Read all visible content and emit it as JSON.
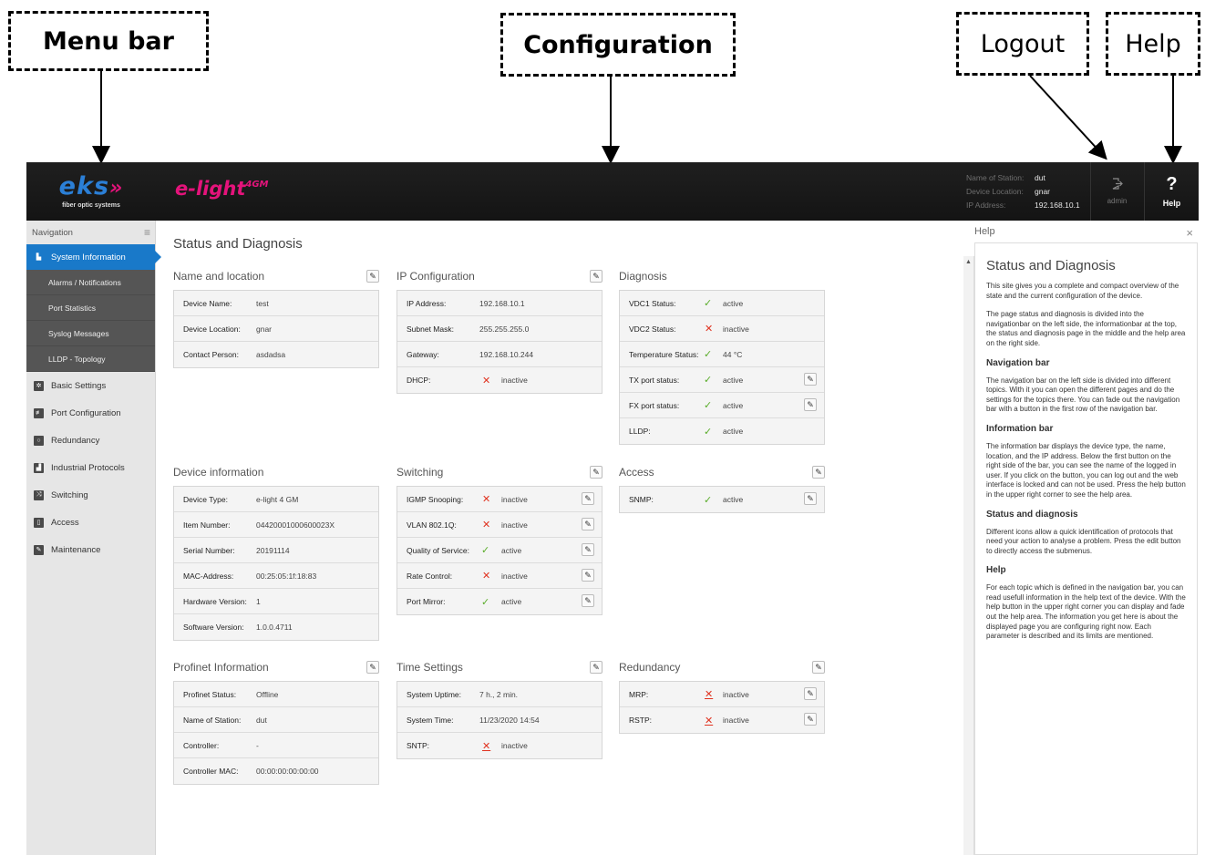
{
  "annotations": {
    "menu_bar": "Menu bar",
    "configuration": "Configuration",
    "logout": "Logout",
    "help": "Help"
  },
  "topbar": {
    "brand": "eks",
    "brand_chevron": "»",
    "brand_tagline": "fiber optic systems",
    "product": "e-light",
    "product_sup": "4GM",
    "station_name_label": "Name of Station:",
    "station_name": "dut",
    "location_label": "Device Location:",
    "location": "gnar",
    "ip_label": "IP Address:",
    "ip": "192.168.10.1",
    "admin_label": "admin",
    "help_symbol": "?",
    "help_label": "Help"
  },
  "sidebar": {
    "header": "Navigation",
    "menu_icon": "≡",
    "items": [
      {
        "label": "System Information",
        "icon": "chart-icon"
      },
      {
        "label": "Basic Settings",
        "icon": "gear-icon"
      },
      {
        "label": "Port Configuration",
        "icon": "port-icon"
      },
      {
        "label": "Redundancy",
        "icon": "ring-icon"
      },
      {
        "label": "Industrial Protocols",
        "icon": "factory-icon"
      },
      {
        "label": "Switching",
        "icon": "switch-icon"
      },
      {
        "label": "Access",
        "icon": "lock-icon"
      },
      {
        "label": "Maintenance",
        "icon": "wrench-icon"
      }
    ],
    "sub_items": [
      "Alarms / Notifications",
      "Port Statistics",
      "Syslog Messages",
      "LLDP - Topology"
    ]
  },
  "main": {
    "title": "Status and Diagnosis",
    "name_location": {
      "title": "Name and location",
      "rows": [
        {
          "k": "Device Name:",
          "v": "test"
        },
        {
          "k": "Device Location:",
          "v": "gnar"
        },
        {
          "k": "Contact Person:",
          "v": "asdadsa"
        }
      ]
    },
    "ip_config": {
      "title": "IP Configuration",
      "rows": [
        {
          "k": "IP Address:",
          "v": "192.168.10.1"
        },
        {
          "k": "Subnet Mask:",
          "v": "255.255.255.0"
        },
        {
          "k": "Gateway:",
          "v": "192.168.10.244"
        },
        {
          "k": "DHCP:",
          "v": "inactive",
          "status": "bad"
        }
      ]
    },
    "diagnosis": {
      "title": "Diagnosis",
      "rows": [
        {
          "k": "VDC1 Status:",
          "v": "active",
          "status": "ok"
        },
        {
          "k": "VDC2 Status:",
          "v": "inactive",
          "status": "bad"
        },
        {
          "k": "Temperature Status:",
          "v": "44 °C",
          "status": "ok"
        },
        {
          "k": "TX port status:",
          "v": "active",
          "status": "ok"
        },
        {
          "k": "FX port status:",
          "v": "active",
          "status": "ok"
        },
        {
          "k": "LLDP:",
          "v": "active",
          "status": "ok"
        }
      ]
    },
    "device_info": {
      "title": "Device information",
      "rows": [
        {
          "k": "Device Type:",
          "v": "e-light 4 GM"
        },
        {
          "k": "Item Number:",
          "v": "04420001000600023X"
        },
        {
          "k": "Serial Number:",
          "v": "20191114"
        },
        {
          "k": "MAC-Address:",
          "v": "00:25:05:1f:18:83"
        },
        {
          "k": "Hardware Version:",
          "v": "1"
        },
        {
          "k": "Software Version:",
          "v": "1.0.0.4711"
        }
      ]
    },
    "switching": {
      "title": "Switching",
      "rows": [
        {
          "k": "IGMP Snooping:",
          "v": "inactive",
          "status": "bad"
        },
        {
          "k": "VLAN 802.1Q:",
          "v": "inactive",
          "status": "bad"
        },
        {
          "k": "Quality of Service:",
          "v": "active",
          "status": "ok"
        },
        {
          "k": "Rate Control:",
          "v": "inactive",
          "status": "bad"
        },
        {
          "k": "Port Mirror:",
          "v": "active",
          "status": "ok"
        }
      ]
    },
    "access": {
      "title": "Access",
      "rows": [
        {
          "k": "SNMP:",
          "v": "active",
          "status": "ok"
        }
      ]
    },
    "profinet": {
      "title": "Profinet Information",
      "rows": [
        {
          "k": "Profinet Status:",
          "v": "Offline"
        },
        {
          "k": "Name of Station:",
          "v": "dut"
        },
        {
          "k": "Controller:",
          "v": "-"
        },
        {
          "k": "Controller MAC:",
          "v": "00:00:00:00:00:00"
        }
      ]
    },
    "time": {
      "title": "Time Settings",
      "rows": [
        {
          "k": "System Uptime:",
          "v": "7 h., 2 min."
        },
        {
          "k": "System Time:",
          "v": "11/23/2020 14:54"
        },
        {
          "k": "SNTP:",
          "v": "inactive",
          "status": "bad"
        }
      ]
    },
    "redundancy": {
      "title": "Redundancy",
      "rows": [
        {
          "k": "MRP:",
          "v": "inactive",
          "status": "bad"
        },
        {
          "k": "RSTP:",
          "v": "inactive",
          "status": "bad"
        }
      ]
    }
  },
  "help_panel": {
    "header": "Help",
    "close": "×",
    "title": "Status and Diagnosis",
    "intro1": "This site gives you a complete and compact overview of the state and the current configuration of the device.",
    "intro2": "The page status and diagnosis is divided into the navigationbar on the left side, the informationbar at the top, the status and diagnosis page in the middle and the help area on the right side.",
    "nav_title": "Navigation bar",
    "nav_text": "The navigation bar on the left side is divided into different topics. With it you can open the different pages and do the settings for the topics there. You can fade out the navigation bar with a button in the first row of the navigation bar.",
    "info_title": "Information bar",
    "info_text": "The information bar displays the device type, the name, location, and the IP address. Below the first button on the right side of the bar, you can see the name of the logged in user. If you click on the button, you can log out and the web interface is locked and can not be used. Press the help button in the upper right corner to see the help area.",
    "status_title": "Status and diagnosis",
    "status_text": "Different icons allow a quick identification of protocols that need your action to analyse a problem. Press the edit button to directly access the submenus.",
    "help_title": "Help",
    "help_text": "For each topic which is defined in the navigation bar, you can read usefull information in the help text of the device. With the help button in the upper right corner you can display and fade out the help area. The information you get here is about the displayed page you are configuring right now. Each parameter is described and its limits are mentioned."
  },
  "colors": {
    "accent": "#1979c9",
    "brand_pink": "#e4137b",
    "status_ok": "#5aad2a",
    "status_bad": "#e0321f"
  }
}
